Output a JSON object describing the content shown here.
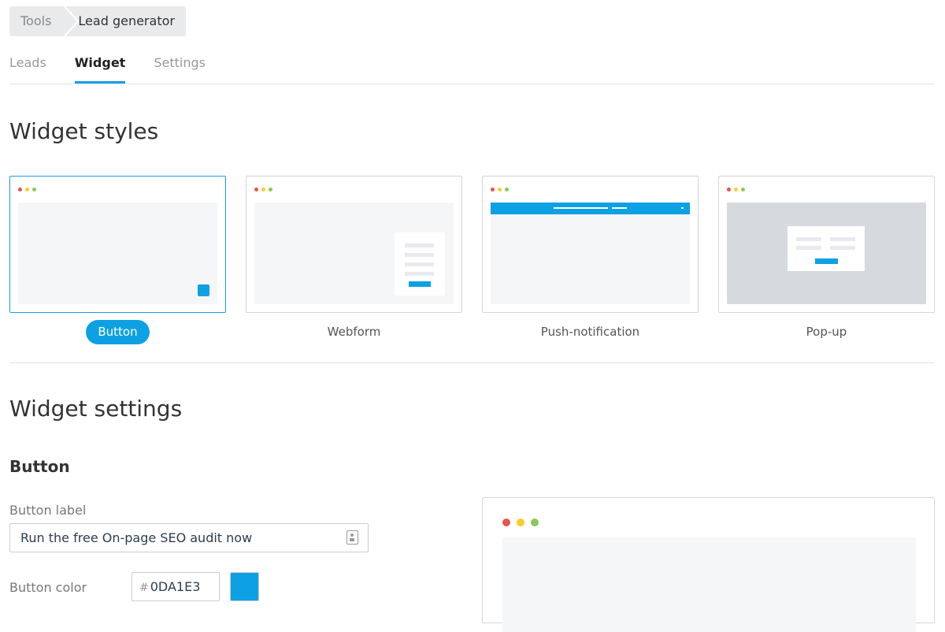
{
  "breadcrumb": {
    "items": [
      "Tools",
      "Lead generator"
    ]
  },
  "tabs": [
    {
      "label": "Leads",
      "active": false
    },
    {
      "label": "Widget",
      "active": true
    },
    {
      "label": "Settings",
      "active": false
    }
  ],
  "widget_styles": {
    "title": "Widget styles",
    "options": [
      {
        "label": "Button",
        "selected": true
      },
      {
        "label": "Webform",
        "selected": false
      },
      {
        "label": "Push-notification",
        "selected": false
      },
      {
        "label": "Pop-up",
        "selected": false
      }
    ]
  },
  "widget_settings": {
    "title": "Widget settings",
    "section_title": "Button",
    "button_label": {
      "label": "Button label",
      "value": "Run the free On-page SEO audit now"
    },
    "button_color": {
      "label": "Button color",
      "hash": "#",
      "value": "0DA1E3"
    }
  },
  "colors": {
    "accent": "#0DA1E3",
    "tab_underline": "#1A9BE6"
  },
  "icons": {
    "input_icon": "contact-card-icon"
  }
}
